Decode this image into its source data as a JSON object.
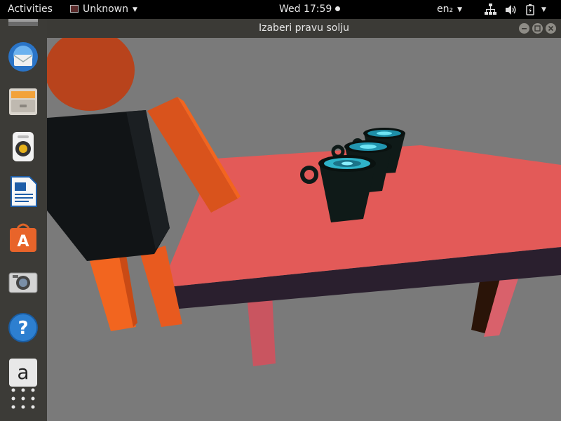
{
  "topbar": {
    "activities": "Activities",
    "app_menu_label": "Unknown",
    "clock": "Wed 17:59",
    "lang": "en₂"
  },
  "window": {
    "title": "Izaberi pravu solju"
  },
  "dock": {
    "items": [
      "thunderbird-icon",
      "files-icon",
      "rhythmbox-icon",
      "writer-icon",
      "software-center-icon",
      "camera-icon",
      "help-icon",
      "amazon-icon",
      "show-apps-icon"
    ]
  },
  "colors": {
    "topbar_bg": "#000000",
    "dock_bg": "#3c3b37",
    "titlebar_bg": "#3b3a36",
    "scene_bg": "#7a7a7a",
    "table_top": "#e35a58",
    "table_edge": "#2a1f2e",
    "cup": "#0f1a18",
    "cup_liquid": "#2fb3c9",
    "figure_body": "#111416",
    "figure_head": "#b8431c",
    "figure_limbs": "#e85a1f"
  }
}
